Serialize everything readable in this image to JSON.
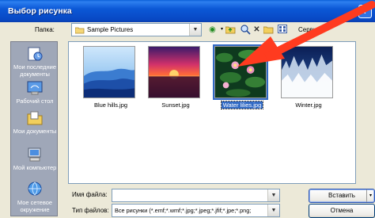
{
  "window": {
    "title": "Выбор рисунка",
    "help_glyph": "?"
  },
  "toolbar": {
    "folder_label": "Папка:",
    "folder_value": "Sample Pictures",
    "tools_label": "Сервис",
    "icons": [
      "back-icon",
      "up-folder-icon",
      "search-web-icon",
      "delete-icon",
      "new-folder-icon",
      "views-icon"
    ]
  },
  "places": [
    {
      "label": "Мои последние документы",
      "icon": "recent-documents-icon"
    },
    {
      "label": "Рабочий стол",
      "icon": "desktop-icon"
    },
    {
      "label": "Мои документы",
      "icon": "my-documents-icon"
    },
    {
      "label": "Мой компьютер",
      "icon": "my-computer-icon"
    },
    {
      "label": "Мое сетевое окружение",
      "icon": "network-icon"
    }
  ],
  "files": [
    {
      "name": "Blue hills.jpg",
      "selected": false
    },
    {
      "name": "Sunset.jpg",
      "selected": false
    },
    {
      "name": "Water lilies.jpg",
      "selected": true
    },
    {
      "name": "Winter.jpg",
      "selected": false
    }
  ],
  "bottom": {
    "filename_label": "Имя файла:",
    "filename_value": "",
    "filetype_label": "Тип файлов:",
    "filetype_value": "Все рисунки (*.emf;*.wmf;*.jpg;*.jpeg;*.jfif;*.jpe;*.png;",
    "insert_label": "Вставить",
    "cancel_label": "Отмена"
  },
  "colors": {
    "title_bar": "#0b58d6",
    "places_bar": "#9fa7b8",
    "selection": "#316ac5",
    "annotation_arrow": "#ff3b1f"
  }
}
